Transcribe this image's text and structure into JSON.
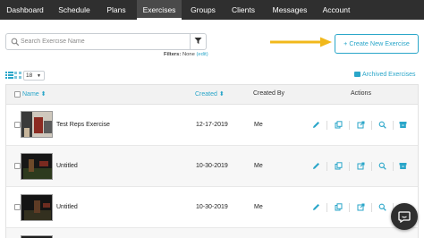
{
  "nav": {
    "items": [
      {
        "label": "Dashboard"
      },
      {
        "label": "Schedule"
      },
      {
        "label": "Plans"
      },
      {
        "label": "Exercises"
      },
      {
        "label": "Groups"
      },
      {
        "label": "Clients"
      },
      {
        "label": "Messages"
      },
      {
        "label": "Account"
      }
    ],
    "active": "Exercises"
  },
  "search": {
    "placeholder": "Search Exercise Name",
    "value": "",
    "icon": "search-icon",
    "filter_icon": "filter-funnel-icon"
  },
  "filters": {
    "label": "Filters:",
    "value": "None",
    "edit": "(edit)"
  },
  "create_button": {
    "label": "+ Create New Exercise"
  },
  "list_controls": {
    "page_size": "18",
    "archived_label": "Archived Exercises"
  },
  "table": {
    "headers": {
      "name": "Name ⬍",
      "created": "Created ⬍",
      "created_by": "Created By",
      "actions": "Actions"
    },
    "rows": [
      {
        "name": "Test Reps Exercise",
        "created": "12-17-2019",
        "created_by": "Me"
      },
      {
        "name": "Untitled",
        "created": "10-30-2019",
        "created_by": "Me"
      },
      {
        "name": "Untitled",
        "created": "10-30-2019",
        "created_by": "Me"
      }
    ],
    "action_icons": [
      "edit-pencil-icon",
      "copy-icon",
      "open-external-icon",
      "preview-search-icon",
      "archive-icon"
    ]
  },
  "colors": {
    "accent": "#2aa6c9",
    "nav_bg": "#2f2f2f",
    "arrow": "#f1b81b"
  },
  "chat_icon": "chat-bubble-icon"
}
